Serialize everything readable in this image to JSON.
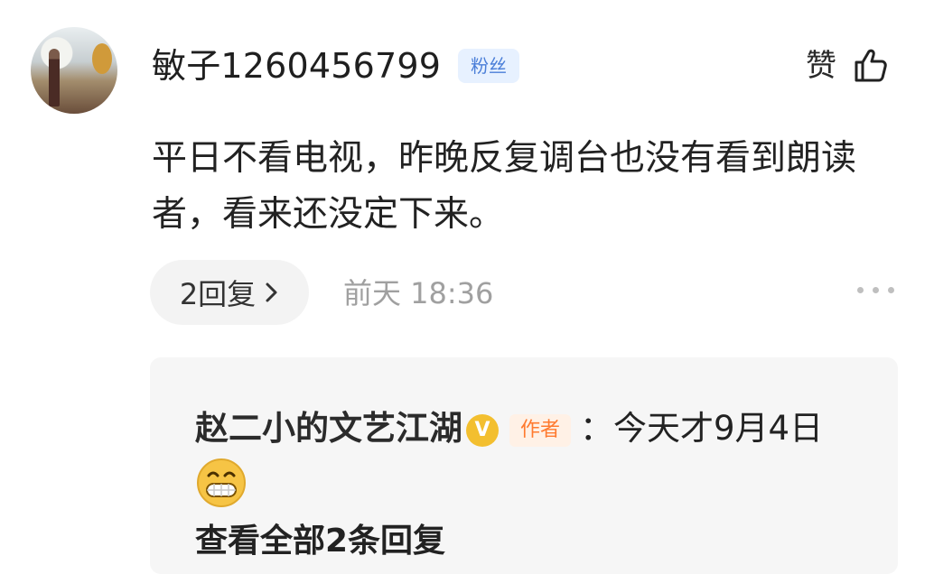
{
  "comment": {
    "username": "敏子1260456799",
    "badge": "粉丝",
    "like_label": "赞",
    "text": "平日不看电视，昨晚反复调台也没有看到朗读者，看来还没定下来。",
    "reply_count_label": "2回复",
    "time_label": "前天  18:36"
  },
  "reply": {
    "author": "赵二小的文艺江湖",
    "verified_mark": "V",
    "author_tag": "作者",
    "separator": "：",
    "text": "今天才9月4日",
    "view_all_label": "查看全部2条回复"
  },
  "colors": {
    "badge_bg": "#e7f1ff",
    "badge_text": "#4a7ed8",
    "author_tag_text": "#ff7a2f",
    "verified": "#f3bf2f",
    "secondary_text": "#a0a0a0"
  },
  "icons": {
    "like": "thumb-up-icon",
    "reply_chevron": "chevron-right-icon",
    "more": "more-dots-icon",
    "verified": "verified-v-icon",
    "emoji": "grin-emoji-icon"
  }
}
